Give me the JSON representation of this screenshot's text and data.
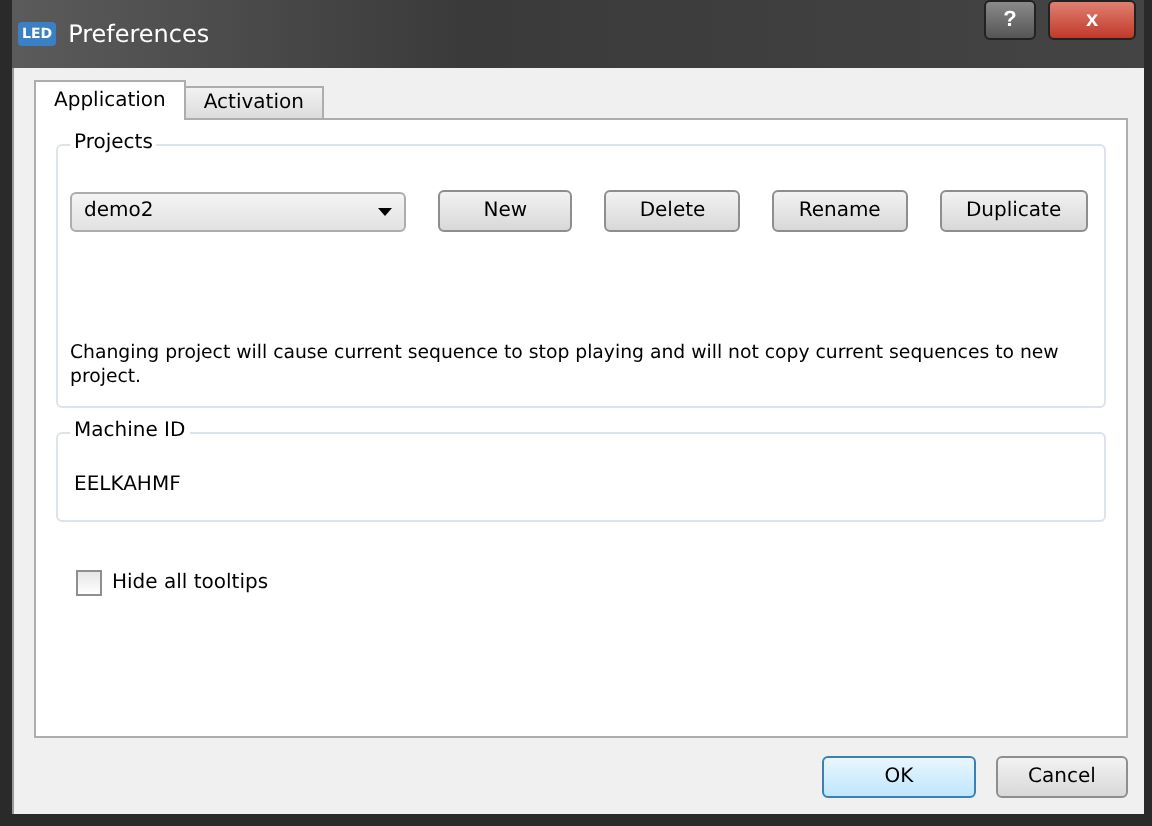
{
  "window": {
    "title": "Preferences",
    "icon_text": "LED"
  },
  "title_buttons": [
    {
      "kind": "help",
      "label": "?"
    },
    {
      "kind": "close",
      "label": "x"
    }
  ],
  "tabs": [
    {
      "label": "Application",
      "selected": true
    },
    {
      "label": "Activation",
      "selected": false
    }
  ],
  "projects": {
    "title": "Projects",
    "dropdown": {
      "value": "demo2"
    },
    "buttons": [
      "New",
      "Delete",
      "Rename",
      "Duplicate"
    ],
    "note": "Changing project will cause current sequence to stop playing and will not copy current sequences to new project."
  },
  "machine_id": {
    "title": "Machine ID",
    "value": "EELKAHMF"
  },
  "hide_tooltips": {
    "label": "Hide all tooltips",
    "checked": false
  },
  "footer_buttons": [
    {
      "label": "OK",
      "default": true
    },
    {
      "label": "Cancel",
      "default": false
    }
  ]
}
